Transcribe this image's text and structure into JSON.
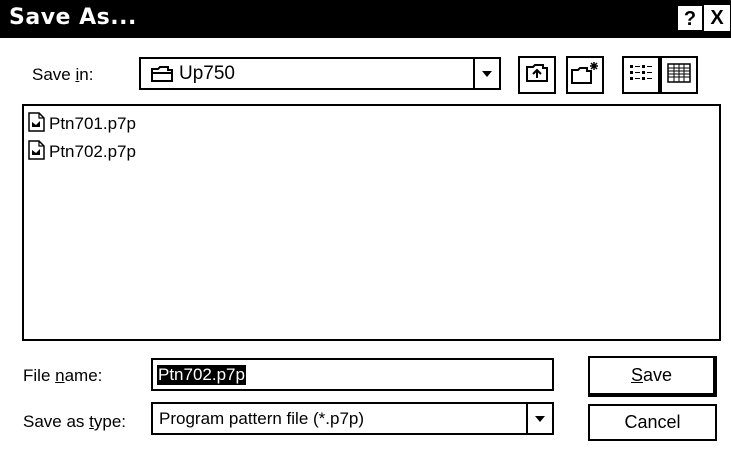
{
  "window": {
    "title": "Save As...",
    "help_glyph": "?",
    "close_glyph": "X"
  },
  "save_in": {
    "label_pre": "Save ",
    "label_hotkey": "i",
    "label_post": "n:",
    "folder": "Up750",
    "folder_icon": "folder-icon"
  },
  "toolbar": [
    {
      "name": "up-one-level-button",
      "icon": "up-folder-icon"
    },
    {
      "name": "create-new-folder-button",
      "icon": "new-folder-icon"
    },
    {
      "name": "list-view-button",
      "icon": "list-view-icon"
    },
    {
      "name": "details-view-button",
      "icon": "details-view-icon"
    }
  ],
  "files": [
    {
      "name": "Ptn701.p7p",
      "icon": "file-icon"
    },
    {
      "name": "Ptn702.p7p",
      "icon": "file-icon"
    }
  ],
  "file_name": {
    "label_pre": "File ",
    "label_hotkey": "n",
    "label_post": "ame:",
    "value": "Ptn702.p7p"
  },
  "save_as_type": {
    "label_pre": "Save as ",
    "label_hotkey": "t",
    "label_post": "ype:",
    "value": "Program pattern file (*.p7p)"
  },
  "buttons": {
    "save_hotkey": "S",
    "save_rest": "ave",
    "cancel": "Cancel"
  }
}
